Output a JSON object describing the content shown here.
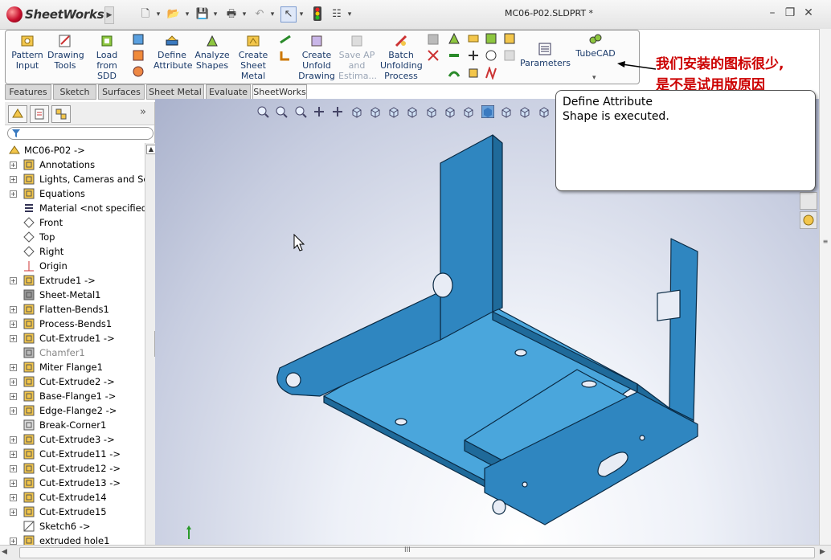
{
  "app": {
    "name": "SheetWorks",
    "doc_title": "MC06-P02.SLDPRT *"
  },
  "window": {
    "minimize": "–",
    "restore": "❐",
    "close": "✕"
  },
  "ribbon": {
    "buttons": [
      {
        "id": "pattern-input",
        "label": "Pattern\nInput",
        "enabled": true
      },
      {
        "id": "drawing-tools",
        "label": "Drawing\nTools",
        "enabled": true
      },
      {
        "id": "load-from-sdd",
        "label": "Load\nfrom SDD",
        "enabled": true
      },
      {
        "id": "define-attribute",
        "label": "Define\nAttribute",
        "enabled": true
      },
      {
        "id": "analyze-shapes",
        "label": "Analyze\nShapes",
        "enabled": true
      },
      {
        "id": "create-sheet-metal",
        "label": "Create\nSheet\nMetal ...",
        "enabled": true
      },
      {
        "id": "create-unfold-drawing",
        "label": "Create\nUnfold\nDrawing",
        "enabled": true
      },
      {
        "id": "save-ap-and-estimate",
        "label": "Save AP\nand\nEstima...",
        "enabled": false
      },
      {
        "id": "batch-unfolding-process",
        "label": "Batch\nUnfolding\nProcess",
        "enabled": true
      },
      {
        "id": "parameters",
        "label": "Parameters",
        "enabled": true
      },
      {
        "id": "tubecad",
        "label": "TubeCAD",
        "enabled": true
      }
    ]
  },
  "tabs": [
    "Features",
    "Sketch",
    "Surfaces",
    "Sheet Metal",
    "Evaluate",
    "SheetWorks"
  ],
  "active_tab": "SheetWorks",
  "note": {
    "line1": "我们安装的图标很少,",
    "line2": "是不是试用版原因"
  },
  "tooltip": {
    "line1": "Define Attribute",
    "line2": "Shape is executed."
  },
  "tree": {
    "root": "MC06-P02 ->",
    "items": [
      {
        "label": "Annotations",
        "exp": true,
        "icon": "annotations-icon"
      },
      {
        "label": "Lights, Cameras and Sce",
        "exp": true,
        "icon": "lights-icon"
      },
      {
        "label": "Equations",
        "exp": true,
        "icon": "equations-icon"
      },
      {
        "label": "Material <not specified>",
        "exp": false,
        "icon": "material-icon"
      },
      {
        "label": "Front",
        "exp": false,
        "icon": "plane-icon"
      },
      {
        "label": "Top",
        "exp": false,
        "icon": "plane-icon"
      },
      {
        "label": "Right",
        "exp": false,
        "icon": "plane-icon"
      },
      {
        "label": "Origin",
        "exp": false,
        "icon": "origin-icon"
      },
      {
        "label": "Extrude1 ->",
        "exp": true,
        "icon": "extrude-icon"
      },
      {
        "label": "Sheet-Metal1",
        "exp": false,
        "icon": "sheet-metal-icon"
      },
      {
        "label": "Flatten-Bends1",
        "exp": true,
        "icon": "flatten-icon"
      },
      {
        "label": "Process-Bends1",
        "exp": true,
        "icon": "process-icon"
      },
      {
        "label": "Cut-Extrude1 ->",
        "exp": true,
        "icon": "cut-extrude-icon"
      },
      {
        "label": "Chamfer1",
        "exp": false,
        "icon": "chamfer-icon",
        "grey": true
      },
      {
        "label": "Miter Flange1",
        "exp": true,
        "icon": "miter-icon"
      },
      {
        "label": "Cut-Extrude2 ->",
        "exp": true,
        "icon": "cut-extrude-icon"
      },
      {
        "label": "Base-Flange1 ->",
        "exp": true,
        "icon": "base-flange-icon"
      },
      {
        "label": "Edge-Flange2 ->",
        "exp": true,
        "icon": "edge-flange-icon"
      },
      {
        "label": "Break-Corner1",
        "exp": false,
        "icon": "break-corner-icon"
      },
      {
        "label": "Cut-Extrude3 ->",
        "exp": true,
        "icon": "cut-extrude-icon"
      },
      {
        "label": "Cut-Extrude11 ->",
        "exp": true,
        "icon": "cut-extrude-icon"
      },
      {
        "label": "Cut-Extrude12 ->",
        "exp": true,
        "icon": "cut-extrude-icon"
      },
      {
        "label": "Cut-Extrude13 ->",
        "exp": true,
        "icon": "cut-extrude-icon"
      },
      {
        "label": "Cut-Extrude14",
        "exp": true,
        "icon": "cut-extrude-icon"
      },
      {
        "label": "Cut-Extrude15",
        "exp": true,
        "icon": "cut-extrude-icon"
      },
      {
        "label": "Sketch6 ->",
        "exp": false,
        "icon": "sketch-icon"
      },
      {
        "label": "extruded hole1",
        "exp": true,
        "icon": "hole-icon"
      }
    ]
  },
  "scroll": {
    "hscroll_grip": "III"
  },
  "colors": {
    "part_face": "#2f86c0",
    "part_top": "#4aa6dc",
    "part_edge": "#0a2a44",
    "note_red": "#cc0000"
  }
}
